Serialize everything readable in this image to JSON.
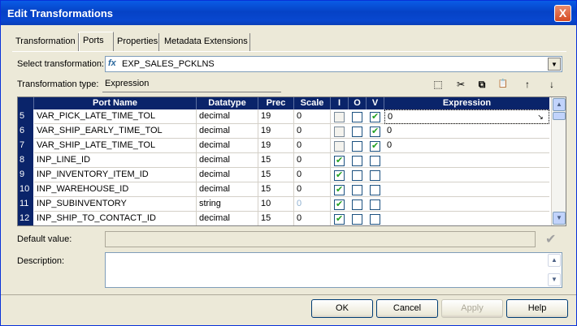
{
  "window": {
    "title": "Edit Transformations",
    "close": "X"
  },
  "tabs": [
    {
      "label": "Transformation"
    },
    {
      "label": "Ports"
    },
    {
      "label": "Properties"
    },
    {
      "label": "Metadata Extensions"
    }
  ],
  "select_transformation": {
    "label": "Select transformation:",
    "value": "EXP_SALES_PCKLNS",
    "icon": "expression-fx-icon"
  },
  "transformation_type": {
    "label": "Transformation type:",
    "value": "Expression"
  },
  "toolbar": {
    "icons": [
      "new-port-icon",
      "cut-icon",
      "copy-icon",
      "paste-icon",
      "move-up-icon",
      "move-down-icon"
    ],
    "glyphs": [
      "⬚",
      "✂",
      "⧉",
      "📋",
      "↑",
      "↓"
    ]
  },
  "grid": {
    "columns": [
      "Port Name",
      "Datatype",
      "Prec",
      "Scale",
      "I",
      "O",
      "V",
      "Expression"
    ],
    "rows": [
      {
        "num": "5",
        "name": "VAR_PICK_LATE_TIME_TOL",
        "datatype": "decimal",
        "prec": "19",
        "scale": "0",
        "i": false,
        "o": false,
        "v": true,
        "expr": "0"
      },
      {
        "num": "6",
        "name": "VAR_SHIP_EARLY_TIME_TOL",
        "datatype": "decimal",
        "prec": "19",
        "scale": "0",
        "i": false,
        "o": false,
        "v": true,
        "expr": "0"
      },
      {
        "num": "7",
        "name": "VAR_SHIP_LATE_TIME_TOL",
        "datatype": "decimal",
        "prec": "19",
        "scale": "0",
        "i": false,
        "o": false,
        "v": true,
        "expr": "0"
      },
      {
        "num": "8",
        "name": "INP_LINE_ID",
        "datatype": "decimal",
        "prec": "15",
        "scale": "0",
        "i": true,
        "o": false,
        "v": false,
        "expr": ""
      },
      {
        "num": "9",
        "name": "INP_INVENTORY_ITEM_ID",
        "datatype": "decimal",
        "prec": "15",
        "scale": "0",
        "i": true,
        "o": false,
        "v": false,
        "expr": ""
      },
      {
        "num": "10",
        "name": "INP_WAREHOUSE_ID",
        "datatype": "decimal",
        "prec": "15",
        "scale": "0",
        "i": true,
        "o": false,
        "v": false,
        "expr": ""
      },
      {
        "num": "11",
        "name": "INP_SUBINVENTORY",
        "datatype": "string",
        "prec": "10",
        "scale": "0",
        "i": true,
        "o": false,
        "v": false,
        "expr": ""
      },
      {
        "num": "12",
        "name": "INP_SHIP_TO_CONTACT_ID",
        "datatype": "decimal",
        "prec": "15",
        "scale": "0",
        "i": true,
        "o": false,
        "v": false,
        "expr": ""
      }
    ]
  },
  "default_value": {
    "label": "Default value:",
    "value": ""
  },
  "description": {
    "label": "Description:",
    "value": ""
  },
  "buttons": {
    "ok": "OK",
    "cancel": "Cancel",
    "apply": "Apply",
    "help": "Help"
  }
}
